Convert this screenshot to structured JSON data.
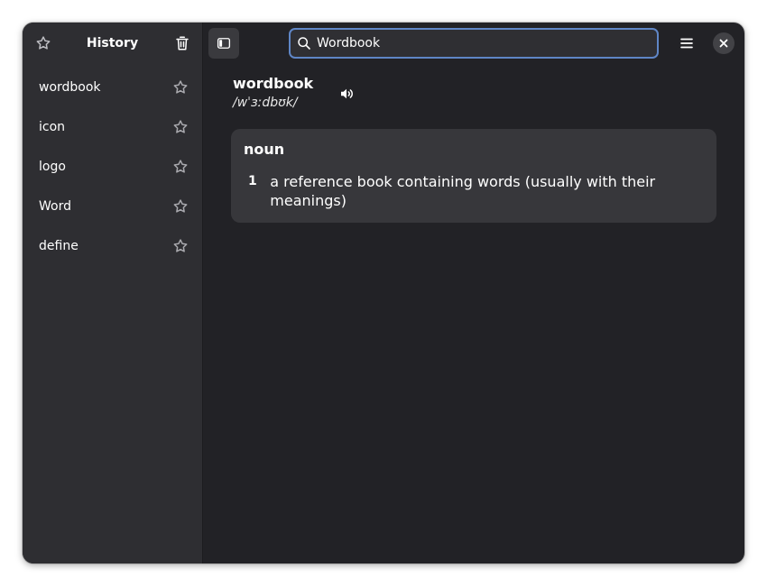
{
  "sidebar": {
    "title": "History",
    "items": [
      {
        "label": "wordbook"
      },
      {
        "label": "icon"
      },
      {
        "label": "logo"
      },
      {
        "label": "Word"
      },
      {
        "label": "define"
      }
    ]
  },
  "search": {
    "value": "Wordbook"
  },
  "entry": {
    "word": "wordbook",
    "pronunciation": "/wˈɜːdbʊk/",
    "part_of_speech": "noun",
    "definitions": [
      {
        "number": "1",
        "text": "a reference book containing words (usually with their meanings)"
      }
    ]
  },
  "colors": {
    "window_bg": "#222226",
    "sidebar_bg": "#2e2e32",
    "card_bg": "#37373b",
    "accent": "#5f86c6"
  }
}
